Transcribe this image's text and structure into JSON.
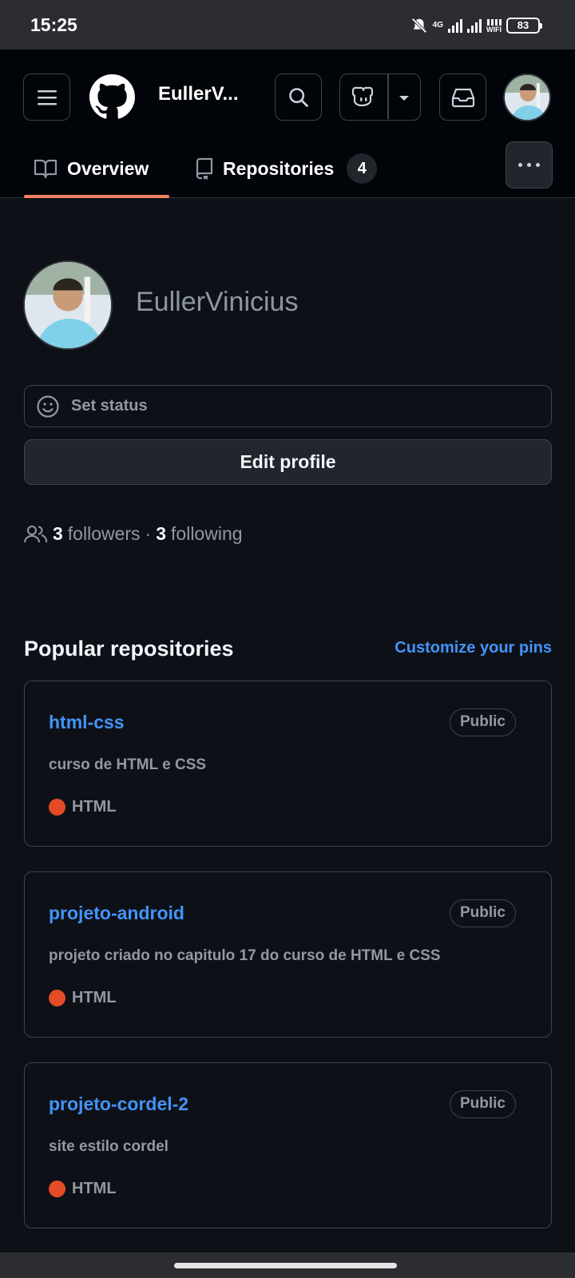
{
  "status_bar": {
    "time": "15:25",
    "network": "4G",
    "wifi": "WIFI",
    "battery": "83"
  },
  "header": {
    "username_short": "EullerV...",
    "icons": [
      "menu-icon",
      "github-logo",
      "search-icon",
      "copilot-icon",
      "caret-down-icon",
      "inbox-icon",
      "avatar"
    ]
  },
  "tabs": [
    {
      "label": "Overview",
      "icon": "book-icon",
      "selected": true
    },
    {
      "label": "Repositories",
      "icon": "repo-icon",
      "count": "4"
    }
  ],
  "profile": {
    "name": "EullerVinicius",
    "set_status": "Set status",
    "edit_profile": "Edit profile",
    "followers_count": "3",
    "followers_label": "followers",
    "separator": "·",
    "following_count": "3",
    "following_label": "following"
  },
  "popular": {
    "title": "Popular repositories",
    "customize": "Customize your pins",
    "repos": [
      {
        "name": "html-css",
        "visibility": "Public",
        "description": "curso de HTML e CSS",
        "language": "HTML",
        "language_color": "#e34c26"
      },
      {
        "name": "projeto-android",
        "visibility": "Public",
        "description": "projeto criado no capitulo 17 do curso de HTML e CSS",
        "language": "HTML",
        "language_color": "#e34c26"
      },
      {
        "name": "projeto-cordel-2",
        "visibility": "Public",
        "description": "site estilo cordel",
        "language": "HTML",
        "language_color": "#e34c26"
      }
    ]
  },
  "colors": {
    "background": "#0d1117",
    "link": "#4493f8",
    "tab_underline": "#f78166",
    "muted": "#9198a1"
  }
}
